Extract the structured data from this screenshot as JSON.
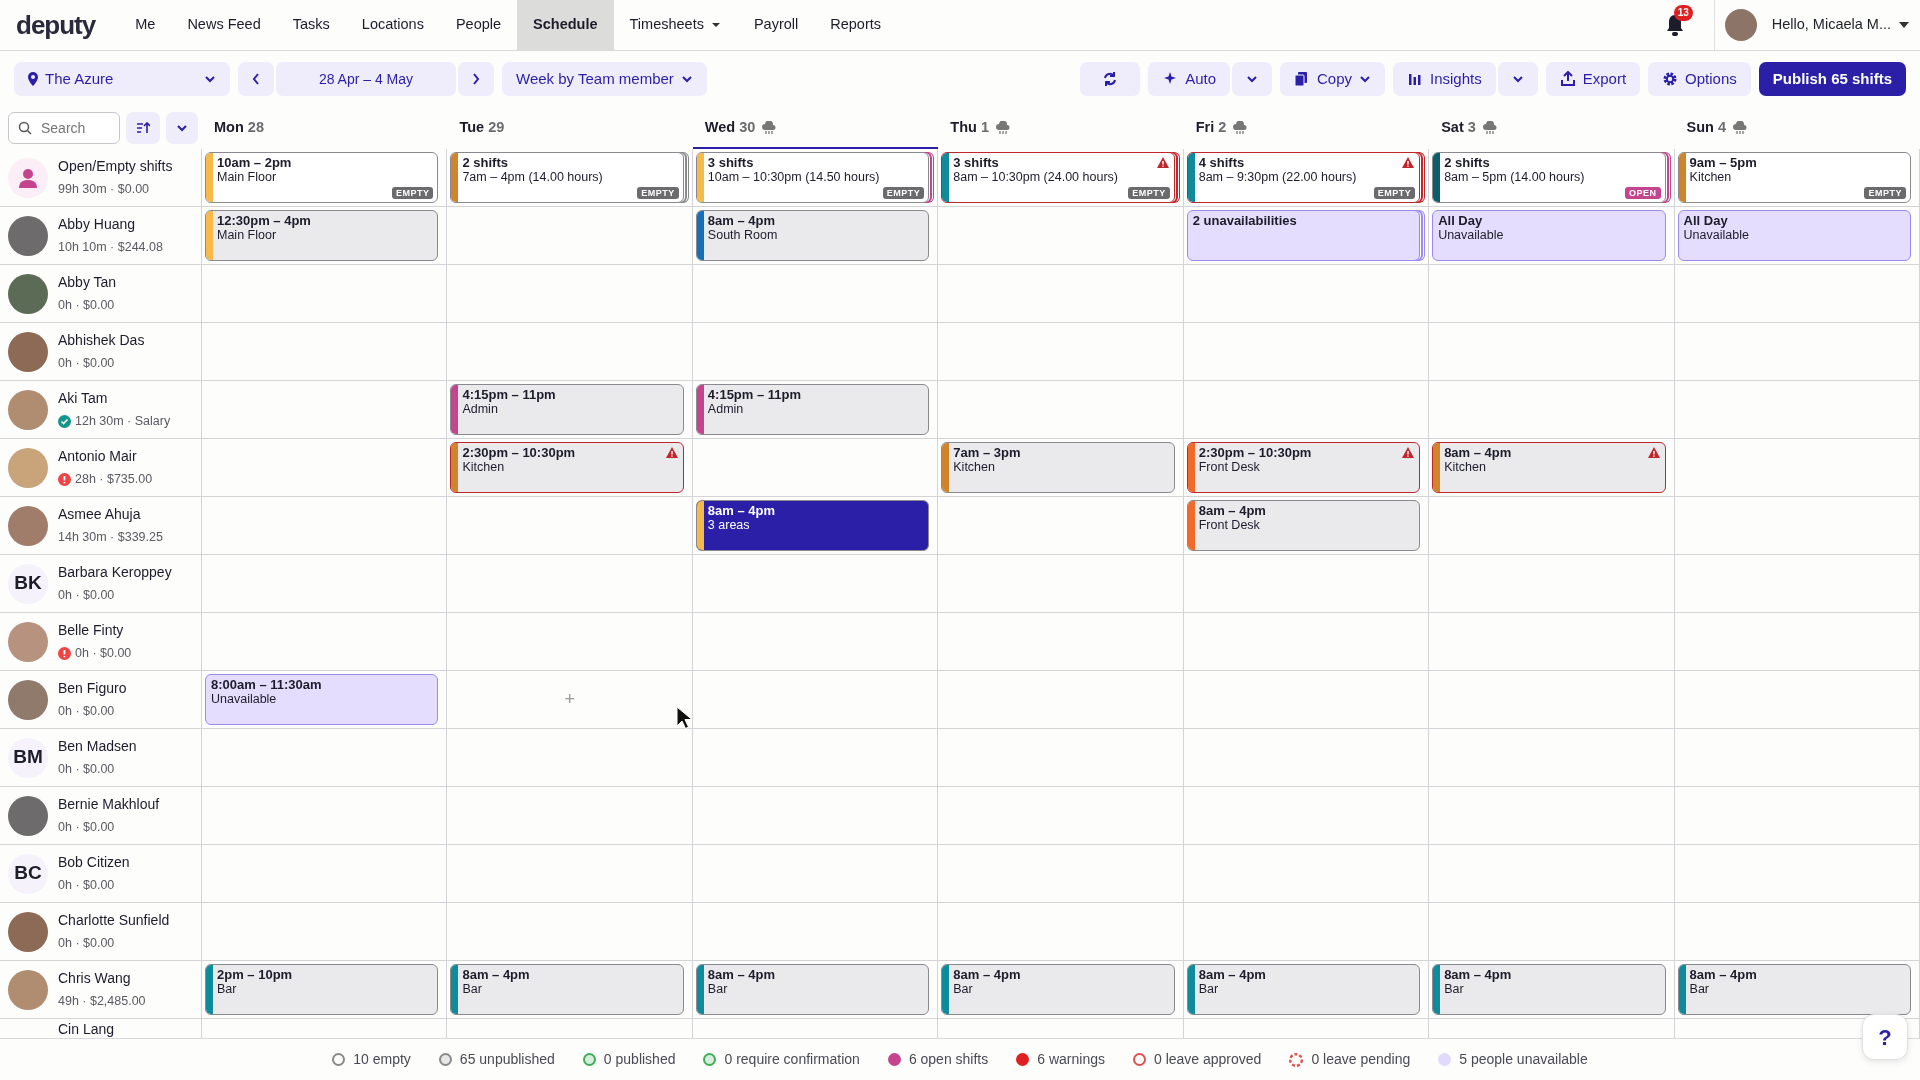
{
  "nav": {
    "logo": "deputy",
    "items": [
      {
        "label": "Me",
        "selected": false,
        "dropdown": false
      },
      {
        "label": "News Feed",
        "selected": false,
        "dropdown": false
      },
      {
        "label": "Tasks",
        "selected": false,
        "dropdown": false
      },
      {
        "label": "Locations",
        "selected": false,
        "dropdown": false
      },
      {
        "label": "People",
        "selected": false,
        "dropdown": false
      },
      {
        "label": "Schedule",
        "selected": true,
        "dropdown": false
      },
      {
        "label": "Timesheets",
        "selected": false,
        "dropdown": true
      },
      {
        "label": "Payroll",
        "selected": false,
        "dropdown": false
      },
      {
        "label": "Reports",
        "selected": false,
        "dropdown": false
      }
    ],
    "notifications": "13",
    "user": "Hello, Micaela M..."
  },
  "toolbar": {
    "location": "The Azure",
    "date_range": "28 Apr – 4 May",
    "view": "Week by Team member",
    "buttons": [
      {
        "kind": "icon"
      },
      {
        "kind": "split",
        "label": "Auto"
      },
      {
        "kind": "caret",
        "label": "Copy"
      },
      {
        "kind": "split",
        "label": "Insights"
      },
      {
        "kind": "plain",
        "label": "Export"
      },
      {
        "kind": "plain",
        "label": "Options"
      },
      {
        "kind": "primary",
        "label": "Publish 65 shifts"
      }
    ]
  },
  "search": {
    "placeholder": "Search"
  },
  "days": [
    {
      "weekday": "Mon",
      "date": "28",
      "selected": false,
      "weather": false
    },
    {
      "weekday": "Tue",
      "date": "29",
      "selected": false,
      "weather": false
    },
    {
      "weekday": "Wed",
      "date": "30",
      "selected": true,
      "weather": true
    },
    {
      "weekday": "Thu",
      "date": "1",
      "selected": false,
      "weather": true
    },
    {
      "weekday": "Fri",
      "date": "2",
      "selected": false,
      "weather": true
    },
    {
      "weekday": "Sat",
      "date": "3",
      "selected": false,
      "weather": true
    },
    {
      "weekday": "Sun",
      "date": "4",
      "selected": false,
      "weather": true
    }
  ],
  "rows": [
    {
      "name": "Open/Empty shifts",
      "stats": "99h 30m · $0.00",
      "confirmed": false,
      "alert": false,
      "avatar": {
        "kind": "open"
      },
      "cells": [
        {
          "kind": "open",
          "title": "10am – 2pm",
          "detail": "Main Floor",
          "color": "#f6b94a",
          "badge": {
            "label": "EMPTY",
            "color": "#6b6b6e"
          },
          "stacked": false,
          "warning": false,
          "selected": false
        },
        {
          "kind": "open",
          "title": "2 shifts",
          "detail": "7am – 4pm (14.00 hours)",
          "color": "#d0842c",
          "badge": {
            "label": "EMPTY",
            "color": "#6b6b6e"
          },
          "stacked": true,
          "warning": false,
          "selected": false
        },
        {
          "kind": "open",
          "title": "3 shifts",
          "detail": "10am – 10:30pm (14.50 hours)",
          "color": "#f6b94a",
          "badge": {
            "label": "EMPTY",
            "color": "#6b6b6e"
          },
          "stacked": true,
          "warning": false,
          "selected": false
        },
        {
          "kind": "open",
          "title": "3 shifts",
          "detail": "8am – 10:30pm (24.00 hours)",
          "color": "#0f8b9c",
          "badge": {
            "label": "EMPTY",
            "color": "#6b6b6e"
          },
          "stacked": true,
          "warning": true,
          "selected": false
        },
        {
          "kind": "open",
          "title": "4 shifts",
          "detail": "8am – 9:30pm (22.00 hours)",
          "color": "#0f8b9c",
          "badge": {
            "label": "EMPTY",
            "color": "#6b6b6e"
          },
          "stacked": true,
          "warning": true,
          "selected": false
        },
        {
          "kind": "open",
          "title": "2 shifts",
          "detail": "8am – 5pm (14.00 hours)",
          "color": "#0c5d6b",
          "badge": {
            "label": "OPEN",
            "color": "#c4458e"
          },
          "stacked": true,
          "warning": false,
          "selected": false
        },
        {
          "kind": "open",
          "title": "9am – 5pm",
          "detail": "Kitchen",
          "color": "#d0842c",
          "badge": {
            "label": "EMPTY",
            "color": "#6b6b6e"
          },
          "stacked": false,
          "warning": false,
          "selected": false
        }
      ]
    },
    {
      "name": "Abby Huang",
      "stats": "10h 10m · $244.08",
      "confirmed": false,
      "alert": false,
      "avatar": {
        "kind": "photo"
      },
      "cells": [
        {
          "kind": "shift",
          "title": "12:30pm – 4pm",
          "detail": "Main Floor",
          "color": "#f6b94a",
          "stacked": false,
          "warning": false,
          "selected": false
        },
        null,
        {
          "kind": "shift",
          "title": "8am – 4pm",
          "detail": "South Room",
          "color": "#1670b8",
          "stacked": false,
          "warning": false,
          "selected": false
        },
        null,
        {
          "kind": "unavailable",
          "title": "2 unavailabilities",
          "stacked": true,
          "warning": false,
          "selected": false
        },
        {
          "kind": "unavailable",
          "title": "All Day",
          "detail": "Unavailable",
          "stacked": false,
          "warning": false,
          "selected": false
        },
        {
          "kind": "unavailable",
          "title": "All Day",
          "detail": "Unavailable",
          "stacked": false,
          "warning": false,
          "selected": false
        }
      ]
    },
    {
      "name": "Abby Tan",
      "stats": "0h · $0.00",
      "confirmed": false,
      "alert": false,
      "avatar": {
        "kind": "photo"
      },
      "cells": [
        null,
        null,
        null,
        null,
        null,
        null,
        null
      ]
    },
    {
      "name": "Abhishek Das",
      "stats": "0h · $0.00",
      "confirmed": false,
      "alert": false,
      "avatar": {
        "kind": "photo"
      },
      "cells": [
        null,
        null,
        null,
        null,
        null,
        null,
        null
      ]
    },
    {
      "name": "Aki Tam",
      "stats": "12h 30m · Salary",
      "confirmed": true,
      "alert": false,
      "avatar": {
        "kind": "photo"
      },
      "cells": [
        null,
        {
          "kind": "shift",
          "title": "4:15pm – 11pm",
          "detail": "Admin",
          "color": "#c4458e",
          "stacked": false,
          "warning": false,
          "selected": false
        },
        {
          "kind": "shift",
          "title": "4:15pm – 11pm",
          "detail": "Admin",
          "color": "#c4458e",
          "stacked": false,
          "warning": false,
          "selected": false
        },
        null,
        null,
        null,
        null
      ]
    },
    {
      "name": "Antonio Mair",
      "stats": "28h · $735.00",
      "confirmed": false,
      "alert": true,
      "avatar": {
        "kind": "photo"
      },
      "cells": [
        null,
        {
          "kind": "shift",
          "title": "2:30pm – 10:30pm",
          "detail": "Kitchen",
          "color": "#d0842c",
          "stacked": false,
          "warning": true,
          "selected": false
        },
        null,
        {
          "kind": "shift",
          "title": "7am – 3pm",
          "detail": "Kitchen",
          "color": "#d0842c",
          "stacked": false,
          "warning": false,
          "selected": false
        },
        {
          "kind": "shift",
          "title": "2:30pm – 10:30pm",
          "detail": "Front Desk",
          "color": "#f26a2a",
          "stacked": false,
          "warning": true,
          "selected": false
        },
        {
          "kind": "shift",
          "title": "8am – 4pm",
          "detail": "Kitchen",
          "color": "#d0842c",
          "stacked": false,
          "warning": true,
          "selected": false
        },
        null
      ]
    },
    {
      "name": "Asmee Ahuja",
      "stats": "14h 30m · $339.25",
      "confirmed": false,
      "alert": false,
      "avatar": {
        "kind": "photo"
      },
      "cells": [
        null,
        null,
        {
          "kind": "shift",
          "title": "8am – 4pm",
          "detail": "3 areas",
          "color": "#f6b94a",
          "stacked": false,
          "warning": false,
          "selected": true
        },
        null,
        {
          "kind": "shift",
          "title": "8am – 4pm",
          "detail": "Front Desk",
          "color": "#f26a2a",
          "stacked": false,
          "warning": false,
          "selected": false
        },
        null,
        null
      ]
    },
    {
      "name": "Barbara Keroppey",
      "stats": "0h · $0.00",
      "confirmed": false,
      "alert": false,
      "avatar": {
        "kind": "initials",
        "initials": "BK"
      },
      "cells": [
        null,
        null,
        null,
        null,
        null,
        null,
        null
      ]
    },
    {
      "name": "Belle Finty",
      "stats": "0h · $0.00",
      "confirmed": false,
      "alert": true,
      "avatar": {
        "kind": "photo"
      },
      "cells": [
        null,
        null,
        null,
        null,
        null,
        null,
        null
      ]
    },
    {
      "name": "Ben Figuro",
      "stats": "0h · $0.00",
      "confirmed": false,
      "alert": false,
      "avatar": {
        "kind": "photo"
      },
      "cells": [
        {
          "kind": "unavailable",
          "title": "8:00am – 11:30am",
          "detail": "Unavailable",
          "stacked": false,
          "warning": false,
          "selected": false
        },
        {
          "kind": "add",
          "title": "+"
        },
        null,
        null,
        null,
        null,
        null
      ]
    },
    {
      "name": "Ben Madsen",
      "stats": "0h · $0.00",
      "confirmed": false,
      "alert": false,
      "avatar": {
        "kind": "initials",
        "initials": "BM"
      },
      "cells": [
        null,
        null,
        null,
        null,
        null,
        null,
        null
      ]
    },
    {
      "name": "Bernie Makhlouf",
      "stats": "0h · $0.00",
      "confirmed": false,
      "alert": false,
      "avatar": {
        "kind": "photo"
      },
      "cells": [
        null,
        null,
        null,
        null,
        null,
        null,
        null
      ]
    },
    {
      "name": "Bob Citizen",
      "stats": "0h · $0.00",
      "confirmed": false,
      "alert": false,
      "avatar": {
        "kind": "initials",
        "initials": "BC"
      },
      "cells": [
        null,
        null,
        null,
        null,
        null,
        null,
        null
      ]
    },
    {
      "name": "Charlotte Sunfield",
      "stats": "0h · $0.00",
      "confirmed": false,
      "alert": false,
      "avatar": {
        "kind": "photo"
      },
      "cells": [
        null,
        null,
        null,
        null,
        null,
        null,
        null
      ]
    },
    {
      "name": "Chris Wang",
      "stats": "49h · $2,485.00",
      "confirmed": false,
      "alert": false,
      "avatar": {
        "kind": "photo"
      },
      "cells": [
        {
          "kind": "shift",
          "title": "2pm – 10pm",
          "detail": "Bar",
          "color": "#0f8b9c",
          "stacked": false,
          "warning": false,
          "selected": false
        },
        {
          "kind": "shift",
          "title": "8am – 4pm",
          "detail": "Bar",
          "color": "#0f8b9c",
          "stacked": false,
          "warning": false,
          "selected": false
        },
        {
          "kind": "shift",
          "title": "8am – 4pm",
          "detail": "Bar",
          "color": "#0f8b9c",
          "stacked": false,
          "warning": false,
          "selected": false
        },
        {
          "kind": "shift",
          "title": "8am – 4pm",
          "detail": "Bar",
          "color": "#0f8b9c",
          "stacked": false,
          "warning": false,
          "selected": false
        },
        {
          "kind": "shift",
          "title": "8am – 4pm",
          "detail": "Bar",
          "color": "#0f8b9c",
          "stacked": false,
          "warning": false,
          "selected": false
        },
        {
          "kind": "shift",
          "title": "8am – 4pm",
          "detail": "Bar",
          "color": "#0f8b9c",
          "stacked": false,
          "warning": false,
          "selected": false
        },
        {
          "kind": "shift",
          "title": "8am – 4pm",
          "detail": "Bar",
          "color": "#0f8b9c",
          "stacked": false,
          "warning": false,
          "selected": false
        }
      ]
    }
  ],
  "cut_row": {
    "name": "Cin Lang"
  },
  "legend": [
    {
      "label": "10 empty",
      "color": "#8a8a8e",
      "kind": "outline"
    },
    {
      "label": "65 unpublished",
      "color": "#8a8a8e",
      "kind": "tinted"
    },
    {
      "label": "0 published",
      "color": "#3fae5a",
      "kind": "tinted"
    },
    {
      "label": "0 require confirmation",
      "color": "#3fae5a",
      "kind": "tinted"
    },
    {
      "label": "6 open shifts",
      "color": "#c4458e",
      "kind": "filled"
    },
    {
      "label": "6 warnings",
      "color": "#e02020",
      "kind": "filled"
    },
    {
      "label": "0 leave approved",
      "color": "#e05050",
      "kind": "outline"
    },
    {
      "label": "0 leave pending",
      "color": "#e05050",
      "kind": "dashed"
    },
    {
      "label": "5 people unavailable",
      "color": "#e2dafb",
      "kind": "filled"
    }
  ],
  "help": "?"
}
